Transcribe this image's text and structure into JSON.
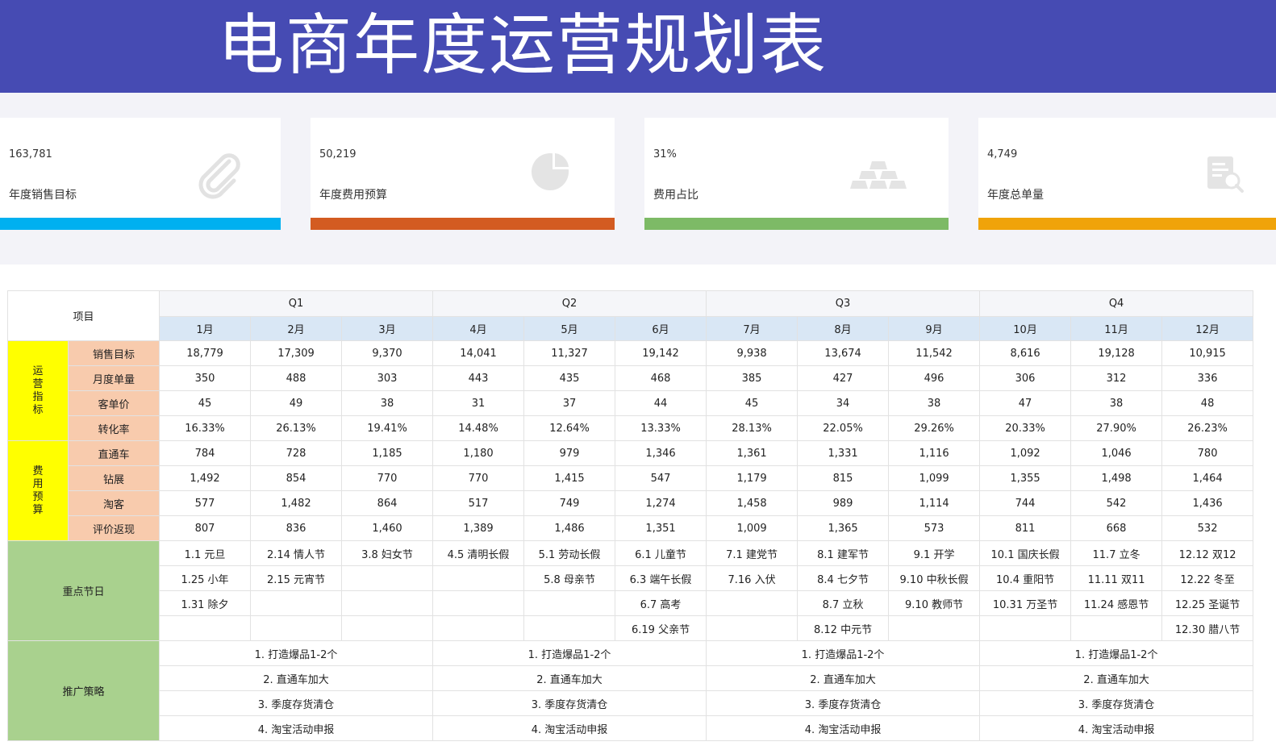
{
  "title": "电商年度运营规划表",
  "kpis": [
    {
      "value": "163,781",
      "label": "年度销售目标",
      "icon": "paperclip-icon",
      "color": "#00b0f0"
    },
    {
      "value": "50,219",
      "label": "年度费用预算",
      "icon": "pie-chart-icon",
      "color": "#d35b21"
    },
    {
      "value": "31%",
      "label": "费用占比",
      "icon": "gold-bars-icon",
      "color": "#7dba66"
    },
    {
      "value": "4,749",
      "label": "年度总单量",
      "icon": "document-search-icon",
      "color": "#f0a30a"
    }
  ],
  "table": {
    "project_header": "项目",
    "quarters": [
      "Q1",
      "Q2",
      "Q3",
      "Q4"
    ],
    "months": [
      "1月",
      "2月",
      "3月",
      "4月",
      "5月",
      "6月",
      "7月",
      "8月",
      "9月",
      "10月",
      "11月",
      "12月"
    ],
    "groups": [
      {
        "name": "运营指标",
        "rows": [
          {
            "label": "销售目标",
            "values": [
              "18,779",
              "17,309",
              "9,370",
              "14,041",
              "11,327",
              "19,142",
              "9,938",
              "13,674",
              "11,542",
              "8,616",
              "19,128",
              "10,915"
            ]
          },
          {
            "label": "月度单量",
            "values": [
              "350",
              "488",
              "303",
              "443",
              "435",
              "468",
              "385",
              "427",
              "496",
              "306",
              "312",
              "336"
            ]
          },
          {
            "label": "客单价",
            "values": [
              "45",
              "49",
              "38",
              "31",
              "37",
              "44",
              "45",
              "34",
              "38",
              "47",
              "38",
              "48"
            ]
          },
          {
            "label": "转化率",
            "values": [
              "16.33%",
              "26.13%",
              "19.41%",
              "14.48%",
              "12.64%",
              "13.33%",
              "28.13%",
              "22.05%",
              "29.26%",
              "20.33%",
              "27.90%",
              "26.23%"
            ]
          }
        ]
      },
      {
        "name": "费用预算",
        "rows": [
          {
            "label": "直通车",
            "values": [
              "784",
              "728",
              "1,185",
              "1,180",
              "979",
              "1,346",
              "1,361",
              "1,331",
              "1,116",
              "1,092",
              "1,046",
              "780"
            ]
          },
          {
            "label": "钻展",
            "values": [
              "1,492",
              "854",
              "770",
              "770",
              "1,415",
              "547",
              "1,179",
              "815",
              "1,099",
              "1,355",
              "1,498",
              "1,464"
            ]
          },
          {
            "label": "淘客",
            "values": [
              "577",
              "1,482",
              "864",
              "517",
              "749",
              "1,274",
              "1,458",
              "989",
              "1,114",
              "744",
              "542",
              "1,436"
            ]
          },
          {
            "label": "评价返现",
            "values": [
              "807",
              "836",
              "1,460",
              "1,389",
              "1,486",
              "1,351",
              "1,009",
              "1,365",
              "573",
              "811",
              "668",
              "532"
            ]
          }
        ]
      }
    ],
    "holidays_label": "重点节日",
    "holidays": [
      [
        "1.1 元旦",
        "2.14 情人节",
        "3.8 妇女节",
        "4.5 清明长假",
        "5.1 劳动长假",
        "6.1 儿童节",
        "7.1 建党节",
        "8.1 建军节",
        "9.1 开学",
        "10.1 国庆长假",
        "11.7 立冬",
        "12.12 双12"
      ],
      [
        "1.25 小年",
        "2.15 元宵节",
        "",
        "",
        "5.8 母亲节",
        "6.3 端午长假",
        "7.16 入伏",
        "8.4 七夕节",
        "9.10 中秋长假",
        "10.4 重阳节",
        "11.11 双11",
        "12.22 冬至"
      ],
      [
        "1.31 除夕",
        "",
        "",
        "",
        "",
        "6.7 高考",
        "",
        "8.7 立秋",
        "9.10 教师节",
        "10.31 万圣节",
        "11.24 感恩节",
        "12.25 圣诞节"
      ],
      [
        "",
        "",
        "",
        "",
        "",
        "6.19 父亲节",
        "",
        "8.12 中元节",
        "",
        "",
        "",
        "12.30 腊八节"
      ]
    ],
    "strategy_label": "推广策略",
    "strategies": [
      [
        "1. 打造爆品1-2个",
        "1. 打造爆品1-2个",
        "1. 打造爆品1-2个",
        "1. 打造爆品1-2个"
      ],
      [
        "2. 直通车加大",
        "2. 直通车加大",
        "2. 直通车加大",
        "2. 直通车加大"
      ],
      [
        "3. 季度存货清仓",
        "3. 季度存货清仓",
        "3. 季度存货清仓",
        "3. 季度存货清仓"
      ],
      [
        "4. 淘宝活动申报",
        "4. 淘宝活动申报",
        "4. 淘宝活动申报",
        "4. 淘宝活动申报"
      ]
    ]
  }
}
